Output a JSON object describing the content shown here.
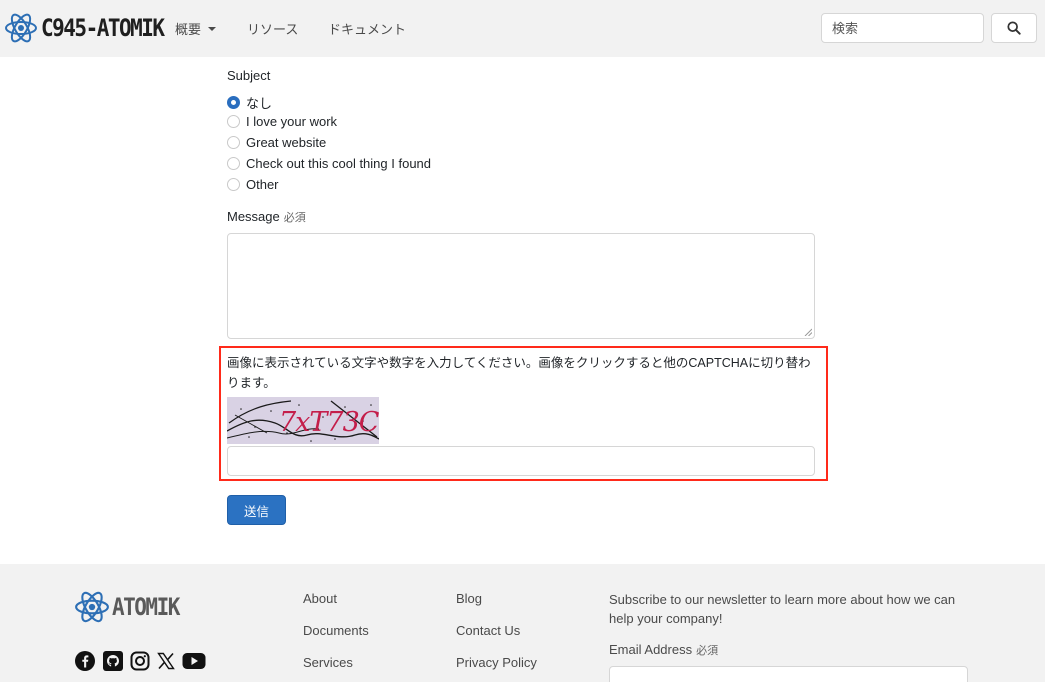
{
  "navbar": {
    "brand": "C945-ATOMIK",
    "items": [
      {
        "label": "概要",
        "has_dropdown": true
      },
      {
        "label": "リソース"
      },
      {
        "label": "ドキュメント"
      }
    ],
    "search": {
      "placeholder": "検索",
      "button_icon": "search-icon"
    }
  },
  "form": {
    "subject_label": "Subject",
    "subject_options": [
      {
        "label": "なし",
        "checked": true
      },
      {
        "label": "I love your work",
        "checked": false
      },
      {
        "label": "Great website",
        "checked": false
      },
      {
        "label": "Check out this cool thing I found",
        "checked": false
      },
      {
        "label": "Other",
        "checked": false
      }
    ],
    "message_label": "Message",
    "required_text": "必須",
    "message_value": "",
    "captcha": {
      "instructions": "画像に表示されている文字や数字を入力してください。画像をクリックすると他のCAPTCHAに切り替わります。",
      "image_text": "7xT73C",
      "value": ""
    },
    "submit_label": "送信",
    "highlight_color": "#ff2a1a",
    "accent_color": "#2b72c2"
  },
  "footer": {
    "brand": "ATOMIK",
    "social_icons": [
      "facebook-icon",
      "github-icon",
      "instagram-icon",
      "x-icon",
      "youtube-icon"
    ],
    "links_col1": [
      "About",
      "Documents",
      "Services"
    ],
    "links_col2": [
      "Blog",
      "Contact Us",
      "Privacy Policy"
    ],
    "newsletter_text": "Subscribe to our newsletter to learn more about how we can help your company!",
    "email_label": "Email Address",
    "required_text": "必須"
  }
}
